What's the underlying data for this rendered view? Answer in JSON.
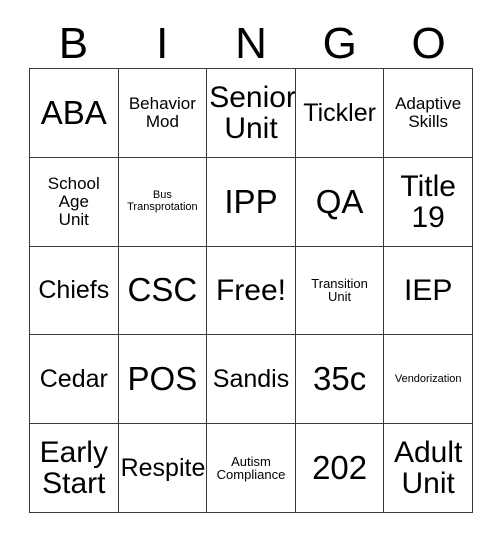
{
  "card": {
    "header_letters": [
      "B",
      "I",
      "N",
      "G",
      "O"
    ],
    "grid": {
      "columns": 5,
      "rows": 5,
      "cells": [
        {
          "label": "ABA",
          "size": "xl"
        },
        {
          "label": "Behavior\nMod",
          "size": "sm"
        },
        {
          "label": "Senior\nUnit",
          "size": "lg"
        },
        {
          "label": "Tickler",
          "size": "md"
        },
        {
          "label": "Adaptive\nSkills",
          "size": "sm"
        },
        {
          "label": "School\nAge\nUnit",
          "size": "sm"
        },
        {
          "label": "Bus\nTransprotation",
          "size": "xxs"
        },
        {
          "label": "IPP",
          "size": "xl"
        },
        {
          "label": "QA",
          "size": "xl"
        },
        {
          "label": "Title\n19",
          "size": "lg"
        },
        {
          "label": "Chiefs",
          "size": "md"
        },
        {
          "label": "CSC",
          "size": "xl"
        },
        {
          "label": "Free!",
          "size": "lg"
        },
        {
          "label": "Transition\nUnit",
          "size": "xs"
        },
        {
          "label": "IEP",
          "size": "lg"
        },
        {
          "label": "Cedar",
          "size": "md"
        },
        {
          "label": "POS",
          "size": "xl"
        },
        {
          "label": "Sandis",
          "size": "md"
        },
        {
          "label": "35c",
          "size": "xl"
        },
        {
          "label": "Vendorization",
          "size": "xxs"
        },
        {
          "label": "Early\nStart",
          "size": "lg"
        },
        {
          "label": "Respite",
          "size": "md"
        },
        {
          "label": "Autism\nCompliance",
          "size": "xs"
        },
        {
          "label": "202",
          "size": "xl"
        },
        {
          "label": "Adult\nUnit",
          "size": "lg"
        }
      ]
    },
    "colors": {
      "background": "#ffffff",
      "text": "#000000",
      "border": "#3a3a3a"
    }
  }
}
